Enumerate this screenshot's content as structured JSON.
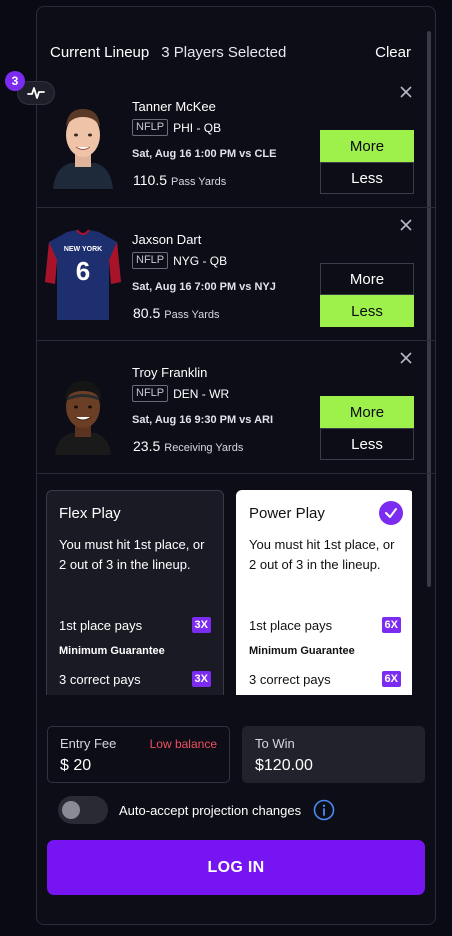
{
  "header": {
    "title": "Current Lineup",
    "count_text": "3 Players Selected",
    "clear_label": "Clear"
  },
  "badge": {
    "count": "3",
    "icon": "activity-icon"
  },
  "players": [
    {
      "name": "Tanner McKee",
      "league": "NFLP",
      "team_pos": "PHI - QB",
      "game": "Sat, Aug 16 1:00 PM vs CLE",
      "projection": "110.5",
      "stat": "Pass Yards",
      "more_label": "More",
      "less_label": "Less",
      "selected": "More"
    },
    {
      "name": "Jaxson Dart",
      "league": "NFLP",
      "team_pos": "NYG - QB",
      "game": "Sat, Aug 16 7:00 PM vs NYJ",
      "projection": "80.5",
      "stat": "Pass Yards",
      "more_label": "More",
      "less_label": "Less",
      "selected": "Less",
      "jersey_text": "NEW YORK",
      "jersey_number": "6"
    },
    {
      "name": "Troy Franklin",
      "league": "NFLP",
      "team_pos": "DEN - WR",
      "game": "Sat, Aug 16 9:30 PM vs ARI",
      "projection": "23.5",
      "stat": "Receiving Yards",
      "more_label": "More",
      "less_label": "Less",
      "selected": "More"
    }
  ],
  "plays": {
    "flex": {
      "title": "Flex Play",
      "desc": "You must hit 1st place, or 2 out of 3 in the lineup.",
      "first_pays": "1st place pays",
      "first_mult": "3X",
      "min_guarantee": "Minimum Guarantee",
      "correct_pays": "3 correct pays",
      "correct_mult": "3X"
    },
    "power": {
      "title": "Power Play",
      "desc": "You must hit 1st place, or 2 out of 3 in the lineup.",
      "first_pays": "1st place pays",
      "first_mult": "6X",
      "min_guarantee": "Minimum Guarantee",
      "correct_pays": "3 correct pays",
      "correct_mult": "6X",
      "selected": true
    }
  },
  "entry": {
    "label": "Entry Fee",
    "warning": "Low balance",
    "amount": "$ 20"
  },
  "win": {
    "label": "To Win",
    "amount": "$120.00"
  },
  "auto_accept": {
    "label": "Auto-accept projection changes",
    "enabled": false
  },
  "login_label": "LOG IN",
  "colors": {
    "accent_purple": "#7614f2",
    "selected_green": "#9ef04a",
    "warning_red": "#f05060",
    "background": "#0d0d18"
  }
}
